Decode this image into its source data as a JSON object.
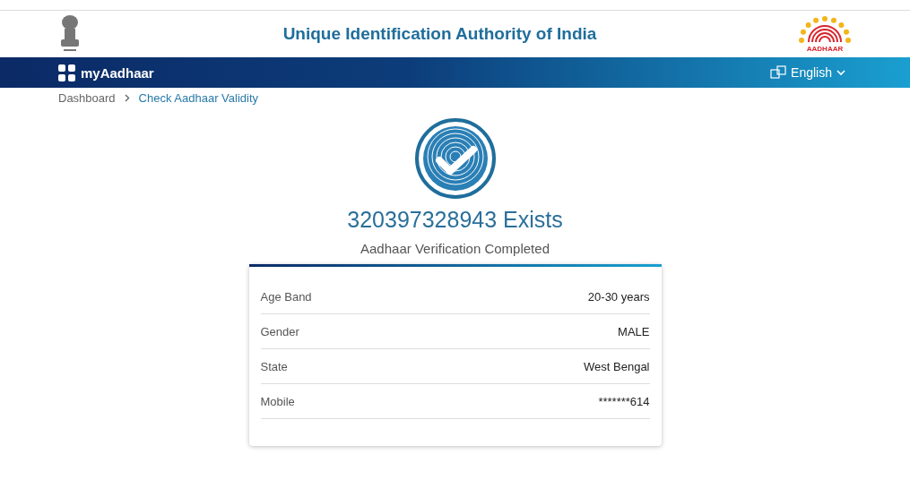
{
  "header": {
    "title": "Unique Identification Authority of India",
    "logo_text": "AADHAAR"
  },
  "navbar": {
    "brand": "myAadhaar",
    "language": "English"
  },
  "breadcrumb": [
    {
      "label": "Dashboard",
      "current": false
    },
    {
      "label": "Check Aadhaar Validity",
      "current": true
    }
  ],
  "result": {
    "title": "320397328943 Exists",
    "subtitle": "Aadhaar Verification Completed"
  },
  "details": [
    {
      "label": "Age Band",
      "value": "20-30 years"
    },
    {
      "label": "Gender",
      "value": "MALE"
    },
    {
      "label": "State",
      "value": "West Bengal"
    },
    {
      "label": "Mobile",
      "value": "*******614"
    }
  ]
}
